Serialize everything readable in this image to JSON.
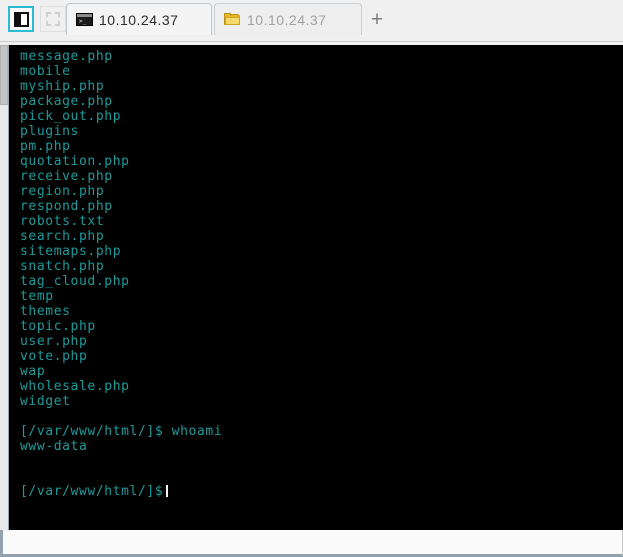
{
  "window": {
    "title": "10.10.24.37"
  },
  "toolbar": {
    "panel_toggle_icon": "panel-toggle-icon",
    "panel_toggle_2_icon": "panel-placeholder-icon",
    "new_tab_label": "+"
  },
  "tabs": [
    {
      "label": "10.10.24.37",
      "icon": "terminal-icon",
      "caret": ">_",
      "active": true,
      "type": "terminal"
    },
    {
      "label": "10.10.24.37",
      "icon": "folder-icon",
      "active": false,
      "type": "sftp"
    }
  ],
  "terminal": {
    "prompt": "[/var/www/html/]$",
    "foreground_color": "#1e9a9a",
    "background_color": "#000000",
    "cursor": "block",
    "lines": [
      "message.php",
      "mobile",
      "myship.php",
      "package.php",
      "pick_out.php",
      "plugins",
      "pm.php",
      "quotation.php",
      "receive.php",
      "region.php",
      "respond.php",
      "robots.txt",
      "search.php",
      "sitemaps.php",
      "snatch.php",
      "tag_cloud.php",
      "temp",
      "themes",
      "topic.php",
      "user.php",
      "vote.php",
      "wap",
      "wholesale.php",
      "widget",
      "",
      "[/var/www/html/]$ whoami",
      "www-data",
      "",
      ""
    ],
    "last_prompt": "[/var/www/html/]$",
    "command": "whoami",
    "command_output": "www-data"
  }
}
